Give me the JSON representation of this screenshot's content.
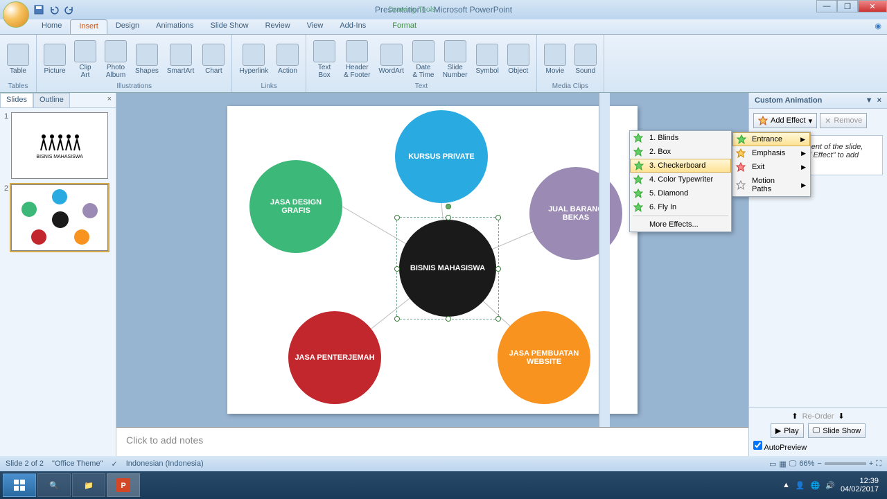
{
  "title": "Presentation1 - Microsoft PowerPoint",
  "context_title": "Drawing Tools",
  "tabs": [
    "Home",
    "Insert",
    "Design",
    "Animations",
    "Slide Show",
    "Review",
    "View",
    "Add-Ins"
  ],
  "context_tab": "Format",
  "active_tab": "Insert",
  "ribbon_groups": [
    {
      "label": "Tables",
      "items": [
        {
          "label": "Table"
        }
      ]
    },
    {
      "label": "Illustrations",
      "items": [
        {
          "label": "Picture"
        },
        {
          "label": "Clip\nArt"
        },
        {
          "label": "Photo\nAlbum"
        },
        {
          "label": "Shapes"
        },
        {
          "label": "SmartArt"
        },
        {
          "label": "Chart"
        }
      ]
    },
    {
      "label": "Links",
      "items": [
        {
          "label": "Hyperlink"
        },
        {
          "label": "Action"
        }
      ]
    },
    {
      "label": "Text",
      "items": [
        {
          "label": "Text\nBox"
        },
        {
          "label": "Header\n& Footer"
        },
        {
          "label": "WordArt"
        },
        {
          "label": "Date\n& Time"
        },
        {
          "label": "Slide\nNumber"
        },
        {
          "label": "Symbol"
        },
        {
          "label": "Object"
        }
      ]
    },
    {
      "label": "Media Clips",
      "items": [
        {
          "label": "Movie"
        },
        {
          "label": "Sound"
        }
      ]
    }
  ],
  "slide_tabs": {
    "slides": "Slides",
    "outline": "Outline"
  },
  "thumb1_caption": "BISNIS MAHASISWA",
  "circles": {
    "blue": "KURSUS PRIVATE",
    "green": "JASA DESIGN GRAFIS",
    "purple": "JUAL BARANG BEKAS",
    "black": "BISNIS MAHASISWA",
    "red": "JASA PENTERJEMAH",
    "orange": "JASA PEMBUATAN WEBSITE"
  },
  "notes_placeholder": "Click to add notes",
  "anim_pane": {
    "title": "Custom Animation",
    "add_effect": "Add Effect",
    "remove": "Remove",
    "hint": "Select an element of the slide, then click \"Add Effect\" to add animation.",
    "reorder": "Re-Order",
    "play": "Play",
    "slideshow": "Slide Show",
    "autopreview": "AutoPreview"
  },
  "effect_categories": [
    {
      "label": "Entrance",
      "hl": true
    },
    {
      "label": "Emphasis"
    },
    {
      "label": "Exit"
    },
    {
      "label": "Motion Paths"
    }
  ],
  "entrance_effects": [
    "1. Blinds",
    "2. Box",
    "3. Checkerboard",
    "4. Color Typewriter",
    "5. Diamond",
    "6. Fly In"
  ],
  "more_effects": "More Effects...",
  "status": {
    "slide": "Slide 2 of 2",
    "theme": "\"Office Theme\"",
    "lang": "Indonesian (Indonesia)",
    "zoom": "66%"
  },
  "tray": {
    "time": "12:39",
    "date": "04/02/2017"
  }
}
